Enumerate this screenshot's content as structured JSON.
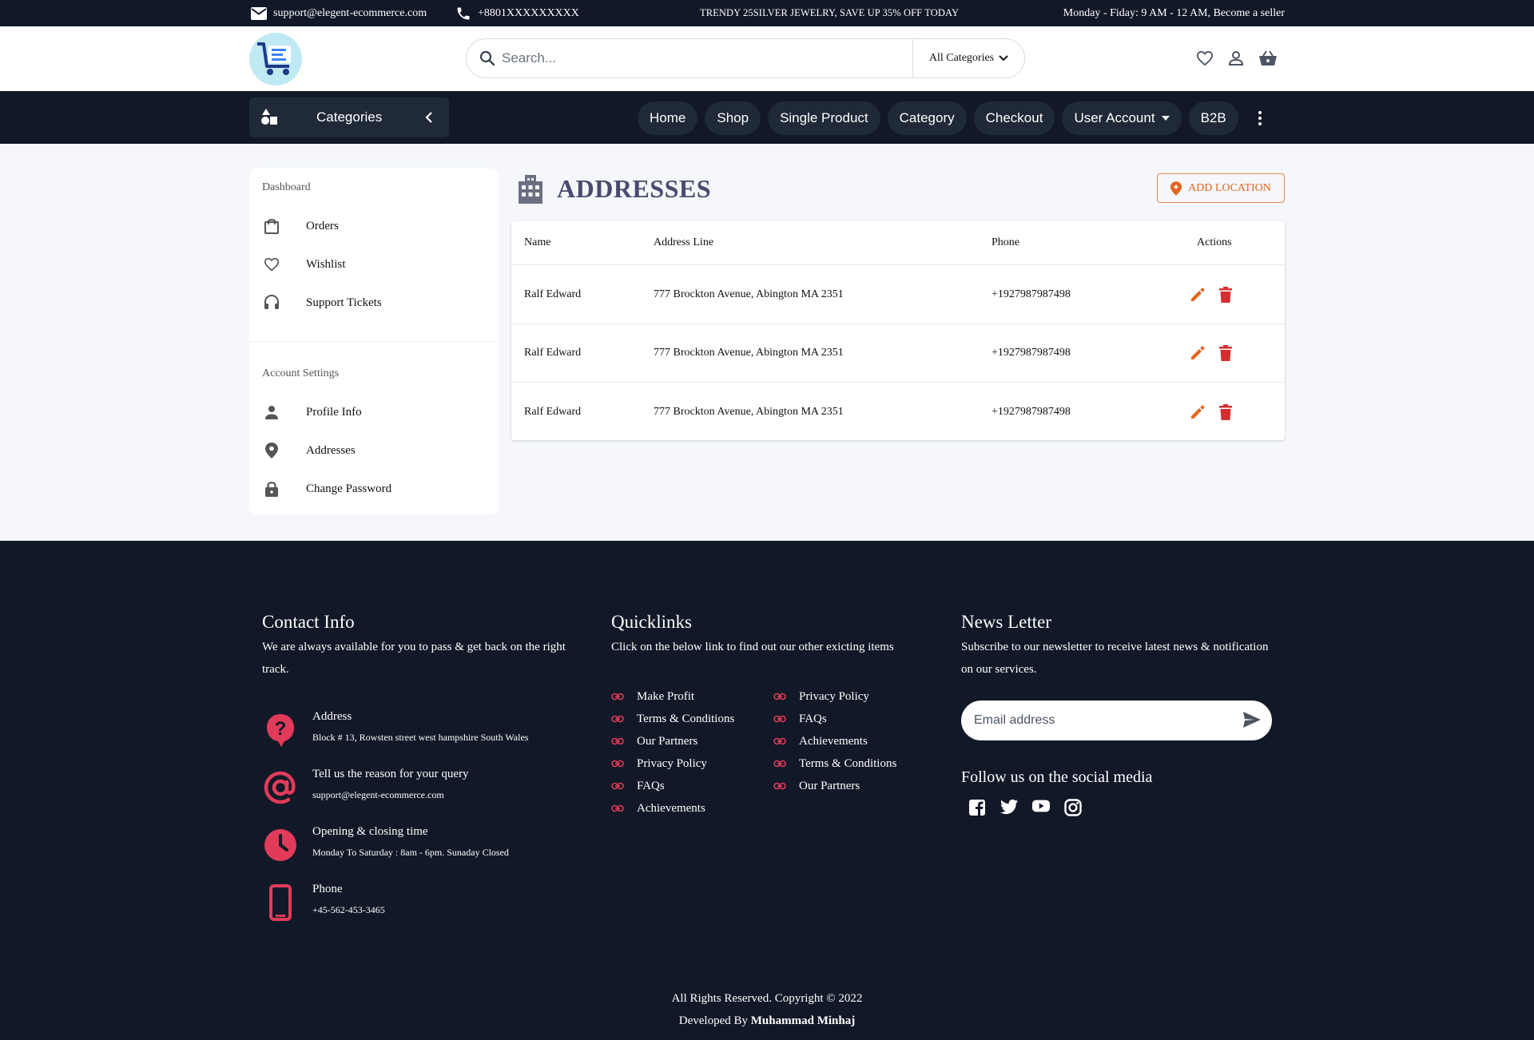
{
  "topbar": {
    "email": "support@elegent-ecommerce.com",
    "phone": "+8801XXXXXXXXX",
    "promo": "TRENDY 25SILVER JEWELRY, SAVE UP 35% OFF TODAY",
    "hours": "Monday - Fiday: 9 AM - 12 AM, Become a seller"
  },
  "header": {
    "search_placeholder": "Search...",
    "category_select": "All Categories",
    "icons": [
      "heart-icon",
      "user-icon",
      "basket-icon"
    ]
  },
  "nav": {
    "categories_label": "Categories",
    "links": [
      "Home",
      "Shop",
      "Single Product",
      "Category",
      "Checkout",
      "User Account",
      "B2B"
    ]
  },
  "sidebar": {
    "dashboard_title": "Dashboard",
    "dashboard_items": [
      {
        "label": "Orders",
        "icon": "bag-icon"
      },
      {
        "label": "Wishlist",
        "icon": "heart-icon"
      },
      {
        "label": "Support Tickets",
        "icon": "headset-icon"
      }
    ],
    "settings_title": "Account Settings",
    "settings_items": [
      {
        "label": "Profile Info",
        "icon": "person-icon"
      },
      {
        "label": "Addresses",
        "icon": "location-icon"
      },
      {
        "label": "Change Password",
        "icon": "lock-icon"
      }
    ]
  },
  "main": {
    "title": "ADDRESSES",
    "add_button": "ADD LOCATION",
    "columns": [
      "Name",
      "Address Line",
      "Phone",
      "Actions"
    ],
    "rows": [
      {
        "name": "Ralf Edward",
        "address": "777 Brockton Avenue, Abington MA 2351",
        "phone": "+1927987987498"
      },
      {
        "name": "Ralf Edward",
        "address": "777 Brockton Avenue, Abington MA 2351",
        "phone": "+1927987987498"
      },
      {
        "name": "Ralf Edward",
        "address": "777 Brockton Avenue, Abington MA 2351",
        "phone": "+1927987987498"
      }
    ]
  },
  "footer": {
    "contact": {
      "title": "Contact Info",
      "desc": "We are always available for you to pass & get back on the right track.",
      "items": [
        {
          "title": "Address",
          "sub": "Block # 13, Rowsten street west hampshire South Wales",
          "icon": "question-icon"
        },
        {
          "title": "Tell us the reason for your query",
          "sub": "support@elegent-ecommerce.com",
          "icon": "at-icon"
        },
        {
          "title": "Opening & closing time",
          "sub": "Monday To Saturday : 8am - 6pm. Sunaday Closed",
          "icon": "clock-icon"
        },
        {
          "title": "Phone",
          "sub": "+45-562-453-3465",
          "icon": "phone-icon"
        }
      ]
    },
    "quicklinks": {
      "title": "Quicklinks",
      "desc": "Click on the below link to find out our other exicting items",
      "col1": [
        "Make Profit",
        "Terms & Conditions",
        "Our Partners",
        "Privacy Policy",
        "FAQs",
        "Achievements"
      ],
      "col2": [
        "Privacy Policy",
        "FAQs",
        "Achievements",
        "Terms & Conditions",
        "Our Partners"
      ]
    },
    "newsletter": {
      "title": "News Letter",
      "desc": "Subscribe to our newsletter to receive latest news & notification on our services.",
      "email_placeholder": "Email address",
      "follow": "Follow us on the social media",
      "social": [
        "facebook-icon",
        "twitter-icon",
        "youtube-icon",
        "instagram-icon"
      ]
    },
    "copyright": "All Rights Reserved. Copyright © 2022",
    "developed_by": "Developed By",
    "developer": "Muhammad Minhaj"
  },
  "colors": {
    "dark": "#111827",
    "accent_orange": "#e3651d",
    "delete_red": "#d32f2f",
    "footer_icon_red": "#e23b5a",
    "title_purple": "#4b4a6e"
  }
}
